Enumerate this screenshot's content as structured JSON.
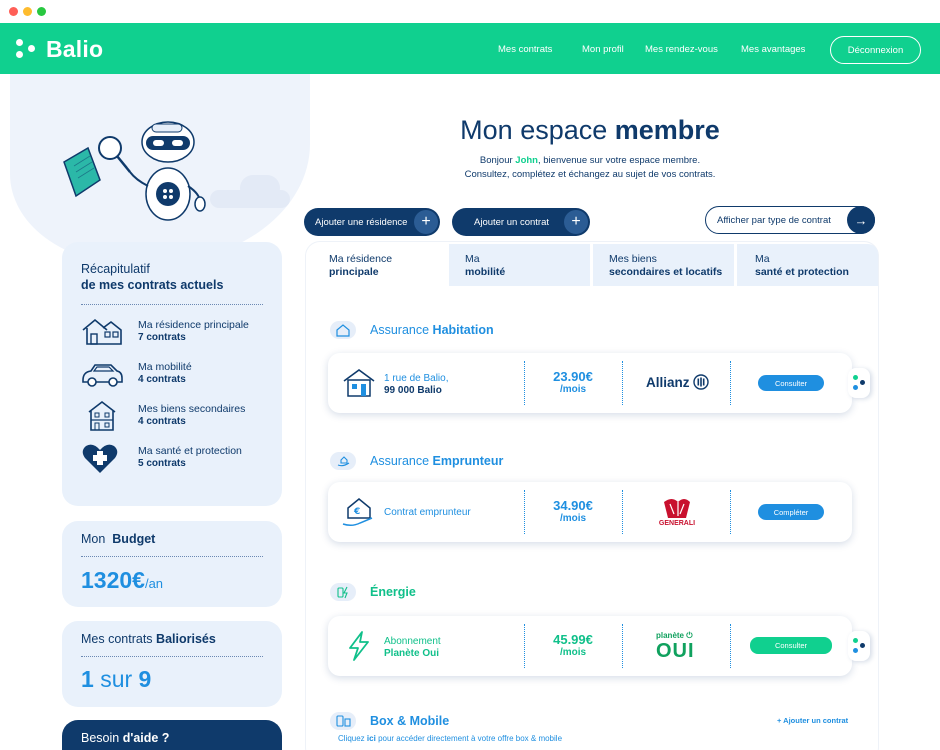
{
  "nav": {
    "brand": "Balio",
    "links": [
      "Mes contrats",
      "Mon profil",
      "Mes rendez-vous",
      "Mes avantages"
    ],
    "logout": "Déconnexion"
  },
  "header": {
    "title_light": "Mon espace",
    "title_bold": "membre",
    "greeting_pre": "Bonjour",
    "greeting_name": "John",
    "greeting_post": ", bienvenue sur votre espace membre.",
    "greeting_line2": "Consultez, complétez et échangez au sujet de vos contrats."
  },
  "actions": {
    "add_residence": "Ajouter une résidence",
    "add_contract": "Ajouter un contrat",
    "filter": "Afficher par type de contrat",
    "plus": "+",
    "arrow": "→"
  },
  "summary": {
    "title_line1": "Récapitulatif",
    "title_line2": "de mes contrats actuels",
    "items": [
      {
        "label": "Ma résidence principale",
        "count": "7 contrats",
        "icon": "house-icon"
      },
      {
        "label": "Ma mobilité",
        "count": "4 contrats",
        "icon": "car-icon"
      },
      {
        "label": "Mes biens secondaires",
        "count": "4 contrats",
        "icon": "building-icon"
      },
      {
        "label": "Ma santé et protection",
        "count": "5 contrats",
        "icon": "heart-cross-icon"
      }
    ]
  },
  "budget": {
    "label_pre": "Mon",
    "label_bold": "Budget",
    "value": "1320€",
    "unit": "/an"
  },
  "baliorises": {
    "label_pre": "Mes contrats",
    "label_bold": "Baliorisés",
    "count": "1",
    "sep": "sur",
    "total": "9"
  },
  "help": {
    "label_pre": "Besoin",
    "label_bold": "d'aide ?"
  },
  "tabs": [
    {
      "line1": "Ma résidence",
      "line2": "principale",
      "active": true
    },
    {
      "line1": "Ma",
      "line2": "mobilité",
      "active": false
    },
    {
      "line1": "Mes biens",
      "line2": "secondaires et locatifs",
      "active": false
    },
    {
      "line1": "Ma",
      "line2": "santé et protection",
      "active": false
    }
  ],
  "sections": {
    "habitation": {
      "title_pre": "Assurance",
      "title_bold": "Habitation",
      "label_line1": "1 rue de Balio,",
      "label_line2": "99 000 Balio",
      "price": "23.90€",
      "per": "/mois",
      "insurer": "Allianz",
      "button": "Consulter"
    },
    "emprunteur": {
      "title_pre": "Assurance",
      "title_bold": "Emprunteur",
      "label": "Contrat emprunteur",
      "price": "34.90€",
      "per": "/mois",
      "insurer": "GENERALI",
      "button": "Compléter"
    },
    "energie": {
      "title": "Énergie",
      "label_line1": "Abonnement",
      "label_line2": "Planète Oui",
      "price": "45.99€",
      "per": "/mois",
      "insurer_small": "planète",
      "insurer_big": "OUI",
      "button": "Consulter"
    },
    "box": {
      "title": "Box & Mobile",
      "add_link": "+ Ajouter un contrat",
      "note_pre": "Cliquez",
      "note_link": "ici",
      "note_post": "pour accéder directement à votre offre box & mobile"
    }
  },
  "colors": {
    "primary_green": "#10d08f",
    "navy": "#0f3a6b",
    "blue": "#1f8fe0",
    "card_bg": "#e9f1fb"
  }
}
